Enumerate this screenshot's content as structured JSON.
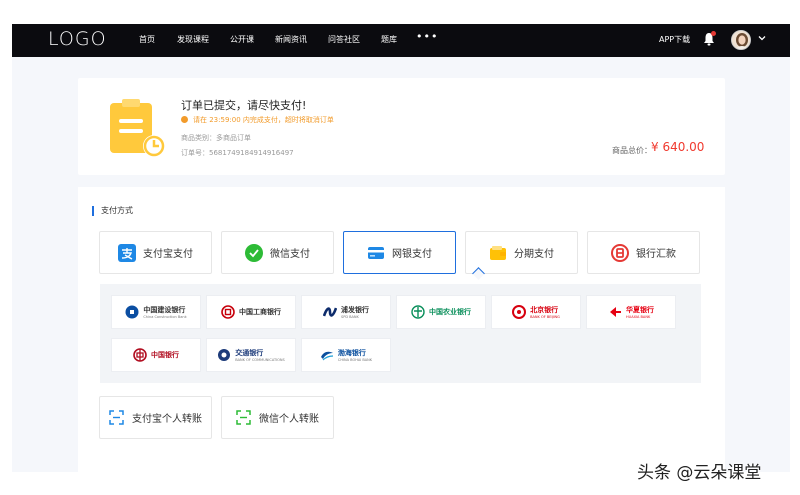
{
  "nav": {
    "logo": "LOGO",
    "items": [
      "首页",
      "发现课程",
      "公开课",
      "新闻资讯",
      "问答社区",
      "题库"
    ],
    "more": "•••",
    "app_download": "APP下载"
  },
  "order": {
    "title": "订单已提交，请尽快支付!",
    "warning": "请在 23:59:00 内完成支付，超时将取消订单",
    "type": "商品类别：多商品订单",
    "order_no": "订单号：5681749184914916497",
    "total_label": "商品总价：",
    "total_value": "¥ 640.00"
  },
  "payment": {
    "heading": "支付方式",
    "methods": [
      {
        "label": "支付宝支付",
        "icon": "alipay-icon",
        "active": false
      },
      {
        "label": "微信支付",
        "icon": "wechat-icon",
        "active": false
      },
      {
        "label": "网银支付",
        "icon": "card-icon",
        "active": true
      },
      {
        "label": "分期支付",
        "icon": "wallet-icon",
        "active": false
      },
      {
        "label": "银行汇款",
        "icon": "bank-icon",
        "active": false
      }
    ],
    "banks": [
      {
        "name": "中国建设银行",
        "sub": "China Construction Bank",
        "icon": "ccb-logo"
      },
      {
        "name": "中国工商银行",
        "sub": "",
        "icon": "icbc-logo"
      },
      {
        "name": "浦发银行",
        "sub": "SPD BANK",
        "icon": "spdb-logo"
      },
      {
        "name": "中国农业银行",
        "sub": "",
        "icon": "abc-logo"
      },
      {
        "name": "北京银行",
        "sub": "BANK OF BEIJING",
        "icon": "bob-logo"
      },
      {
        "name": "华夏银行",
        "sub": "HUAXIA BANK",
        "icon": "hxb-logo"
      },
      {
        "name": "中国银行",
        "sub": "",
        "icon": "boc-logo"
      },
      {
        "name": "交通银行",
        "sub": "BANK OF COMMUNICATIONS",
        "icon": "bocom-logo"
      },
      {
        "name": "渤海银行",
        "sub": "CHINA BOHAI BANK",
        "icon": "cbhb-logo"
      }
    ],
    "transfers": [
      {
        "label": "支付宝个人转账",
        "icon": "scan-icon"
      },
      {
        "label": "微信个人转账",
        "icon": "scan-icon"
      }
    ]
  },
  "colors": {
    "accent": "#1f6fde",
    "price": "#f0392e",
    "warning": "#f29b2b",
    "topbar": "#0b0b0f"
  },
  "watermark": "头条 @云朵课堂"
}
